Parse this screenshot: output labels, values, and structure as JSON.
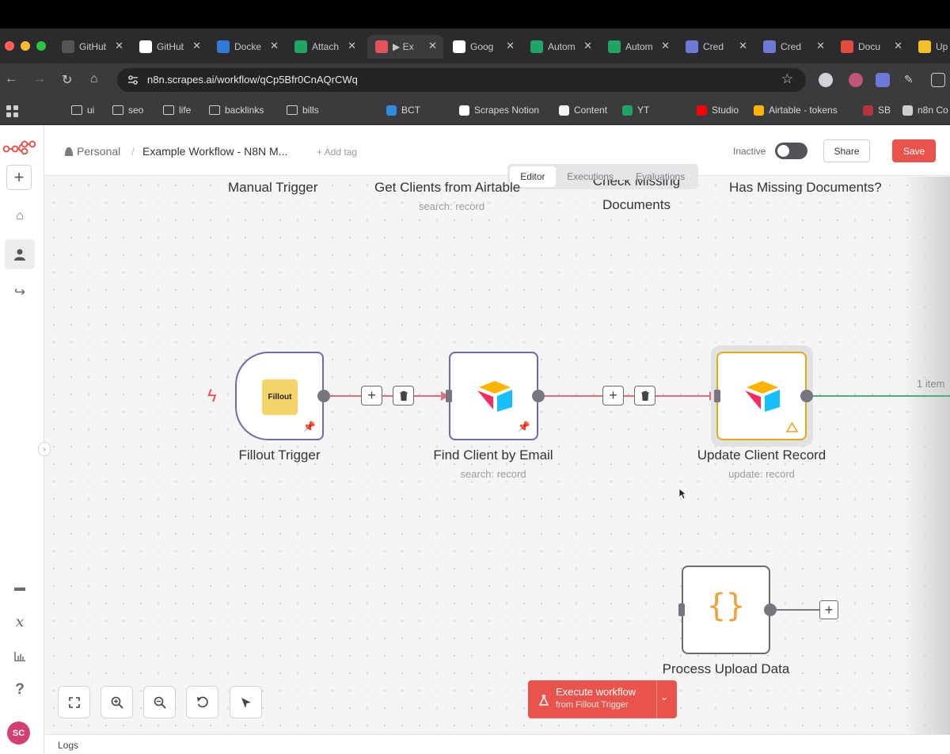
{
  "browser": {
    "tabs": [
      {
        "label": "GitHub",
        "icon": "github-icon",
        "color": "#555555"
      },
      {
        "label": "GitHub",
        "icon": "github-icon",
        "color": "#ffffff"
      },
      {
        "label": "Docker",
        "icon": "docker-icon",
        "color": "#2f7cd6"
      },
      {
        "label": "Attach",
        "icon": "drive-icon",
        "color": "#1fa463"
      },
      {
        "label": "▶ Ex",
        "icon": "n8n-icon",
        "color": "#e0545a"
      },
      {
        "label": "Goog",
        "icon": "sk-icon",
        "color": "#ffffff"
      },
      {
        "label": "Autom",
        "icon": "drive-icon",
        "color": "#1fa463"
      },
      {
        "label": "Autom",
        "icon": "drive-icon",
        "color": "#1fa463"
      },
      {
        "label": "Cred",
        "icon": "api-icon",
        "color": "#6d7bd6"
      },
      {
        "label": "Cred",
        "icon": "api-icon",
        "color": "#6d7bd6"
      },
      {
        "label": "Docu",
        "icon": "gmail-icon",
        "color": "#e24b3c"
      },
      {
        "label": "Up",
        "icon": "notes-icon",
        "color": "#f2c029"
      }
    ],
    "url": "n8n.scrapes.ai/workflow/qCp5Bfr0CnAQrCWq",
    "bookmarks": [
      "ui",
      "seo",
      "life",
      "backlinks",
      "bills",
      "BCT",
      "Scrapes Notion",
      "Content",
      "YT",
      "Studio",
      "Airtable - tokens",
      "SB",
      "n8n Co"
    ]
  },
  "header": {
    "project": "Personal",
    "workflow_name": "Example Workflow - N8N M...",
    "add_tag": "+ Add tag",
    "tabs": [
      "Editor",
      "Executions",
      "Evaluations"
    ],
    "active_tab": "Editor",
    "status": "Inactive",
    "share": "Share",
    "save": "Save"
  },
  "top_nodes": [
    {
      "label": "Manual Trigger",
      "sub": ""
    },
    {
      "label": "Get Clients from Airtable",
      "sub": "search: record"
    },
    {
      "label": "Check Missing Documents",
      "line1": "Check Missing",
      "line2": "Documents",
      "sub": ""
    },
    {
      "label": "Has Missing Documents?",
      "sub": ""
    }
  ],
  "nodes": {
    "fillout": {
      "label": "Fillout Trigger",
      "logo": "Fillout"
    },
    "find_client": {
      "label": "Find Client by Email",
      "sub": "search: record"
    },
    "update_client": {
      "label": "Update Client Record",
      "sub": "update: record"
    },
    "process_upload": {
      "label": "Process Upload Data",
      "glyph": "{}"
    }
  },
  "edge_label": "1 item",
  "execute": {
    "label": "Execute workflow",
    "sub": "from Fillout Trigger"
  },
  "logs": "Logs",
  "user_initials": "SC",
  "colors": {
    "accent": "#e9534c",
    "node_border": "#6b6bb0",
    "success_edge": "#4caf7a",
    "warning": "#e6a817"
  }
}
